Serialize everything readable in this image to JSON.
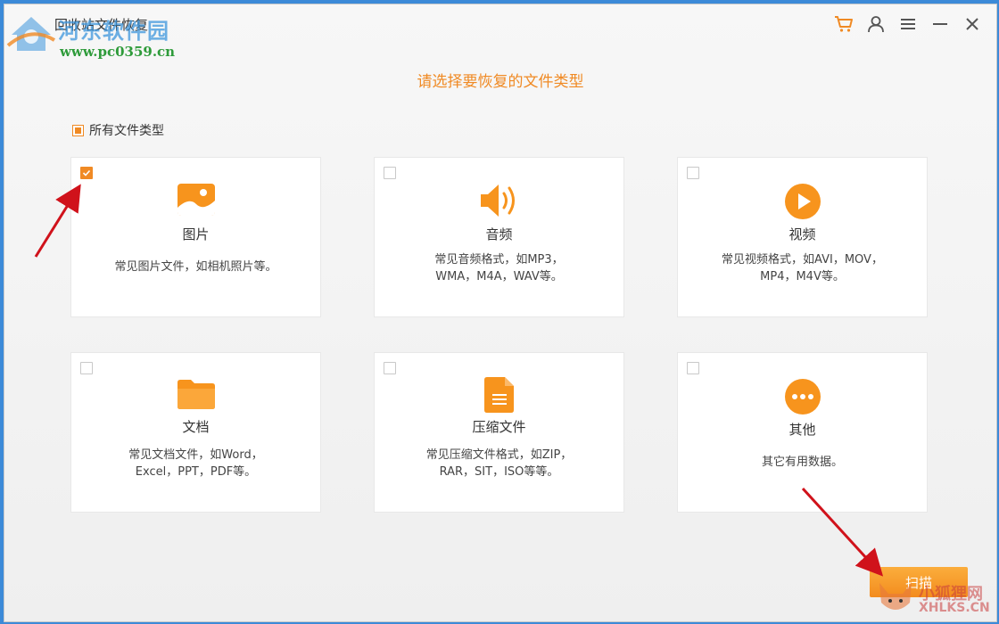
{
  "window": {
    "title": "回收站文件恢复",
    "watermark_site": "河东软件园",
    "watermark_url": "www.pc0359.cn"
  },
  "titlebar": {
    "icons": [
      "cart-icon",
      "user-icon",
      "menu-icon",
      "minimize-icon",
      "close-icon"
    ]
  },
  "heading": "请选择要恢复的文件类型",
  "all_types": {
    "label": "所有文件类型",
    "state": "partial"
  },
  "cards": [
    {
      "title": "图片",
      "desc1": "常见图片文件，如相机照片等。",
      "desc2": "",
      "checked": true,
      "icon": "image-icon"
    },
    {
      "title": "音频",
      "desc1": "常见音频格式，如MP3，",
      "desc2": "WMA，M4A，WAV等。",
      "checked": false,
      "icon": "speaker-icon"
    },
    {
      "title": "视频",
      "desc1": "常见视频格式，如AVI，MOV，",
      "desc2": "MP4，M4V等。",
      "checked": false,
      "icon": "play-icon"
    },
    {
      "title": "文档",
      "desc1": "常见文档文件，如Word，",
      "desc2": "Excel，PPT，PDF等。",
      "checked": false,
      "icon": "folder-icon"
    },
    {
      "title": "压缩文件",
      "desc1": "常见压缩文件格式，如ZIP，",
      "desc2": "RAR，SIT，ISO等等。",
      "checked": false,
      "icon": "archive-icon"
    },
    {
      "title": "其他",
      "desc1": "其它有用数据。",
      "desc2": "",
      "checked": false,
      "icon": "more-icon"
    }
  ],
  "scan_button": "扫描",
  "corner_watermark": {
    "line1": "小狐狸网",
    "line2": "XHLKS.CN"
  },
  "colors": {
    "accent": "#f08a24",
    "text": "#333333"
  }
}
